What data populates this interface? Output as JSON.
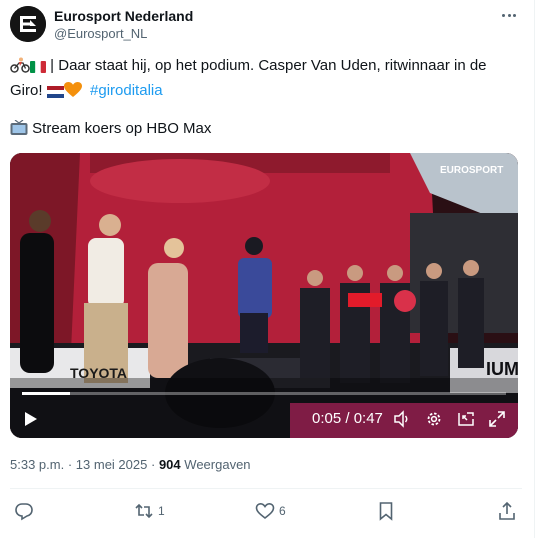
{
  "author": {
    "name": "Eurosport Nederland",
    "handle": "@Eurosport_NL",
    "avatar_icon": "eurosport-logo-icon"
  },
  "tweet": {
    "text_part1": " | Daar staat hij, op het podium. Casper Van Uden, ritwinnaar in de Giro! ",
    "hashtag": "#giroditalia",
    "stream_text": "Stream koers op HBO Max"
  },
  "video": {
    "watermark": "EUROSPORT",
    "time": "0:05 / 0:47",
    "progress_fraction": 0.1,
    "banner_text": "TOYOTA",
    "side_text": "IUMA"
  },
  "meta": {
    "time": "5:33 p.m.",
    "separator": "·",
    "date": "13 mei 2025",
    "views_count": "904",
    "views_label": "Weergaven"
  },
  "actions": {
    "replies": "",
    "retweets": "1",
    "likes": "6"
  },
  "colors": {
    "accent": "#1d9bf0",
    "secondary_text": "#536471",
    "podium_red": "#c0283a"
  }
}
